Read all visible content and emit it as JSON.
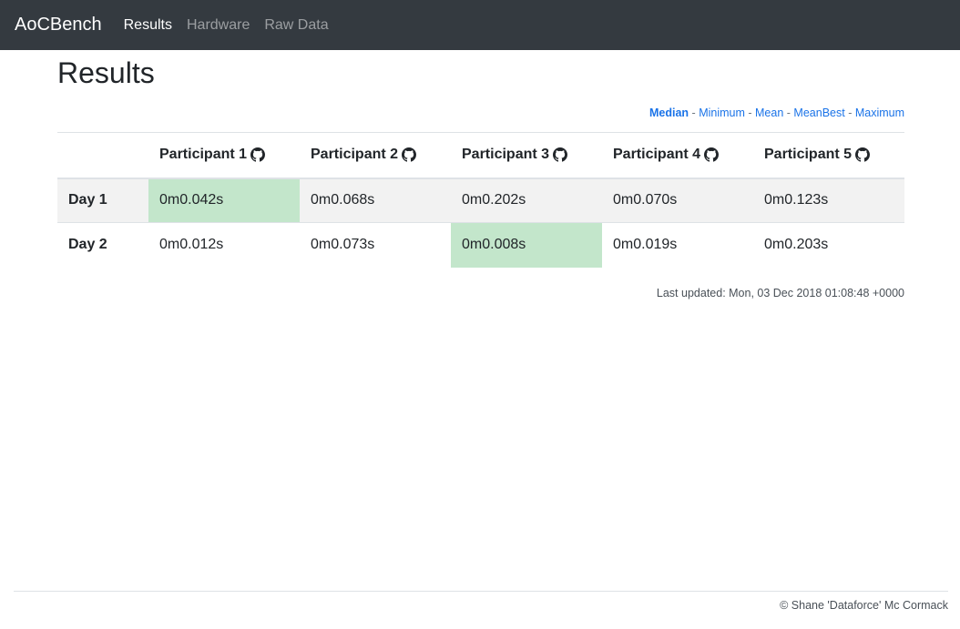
{
  "navbar": {
    "brand": "AoCBench",
    "links": [
      {
        "label": "Results",
        "active": true
      },
      {
        "label": "Hardware",
        "active": false
      },
      {
        "label": "Raw Data",
        "active": false
      }
    ]
  },
  "page": {
    "title": "Results"
  },
  "stat_nav": {
    "options": [
      "Median",
      "Minimum",
      "Mean",
      "MeanBest",
      "Maximum"
    ],
    "selected": "Median",
    "separator": "-"
  },
  "table": {
    "headers": [
      "",
      "Participant 1",
      "Participant 2",
      "Participant 3",
      "Participant 4",
      "Participant 5"
    ],
    "header_icon": "github-icon",
    "rows": [
      {
        "label": "Day 1",
        "values": [
          "0m0.042s",
          "0m0.068s",
          "0m0.202s",
          "0m0.070s",
          "0m0.123s"
        ],
        "best_index": 0
      },
      {
        "label": "Day 2",
        "values": [
          "0m0.012s",
          "0m0.073s",
          "0m0.008s",
          "0m0.019s",
          "0m0.203s"
        ],
        "best_index": 2
      }
    ]
  },
  "last_updated": "Last updated: Mon, 03 Dec 2018 01:08:48 +0000",
  "footer": {
    "text": "© Shane 'Dataforce' Mc Cormack"
  },
  "colors": {
    "navbar_bg": "#343a40",
    "best_cell": "#c3e6cb",
    "link": "#1a73e8",
    "stripe": "#f2f2f2"
  }
}
